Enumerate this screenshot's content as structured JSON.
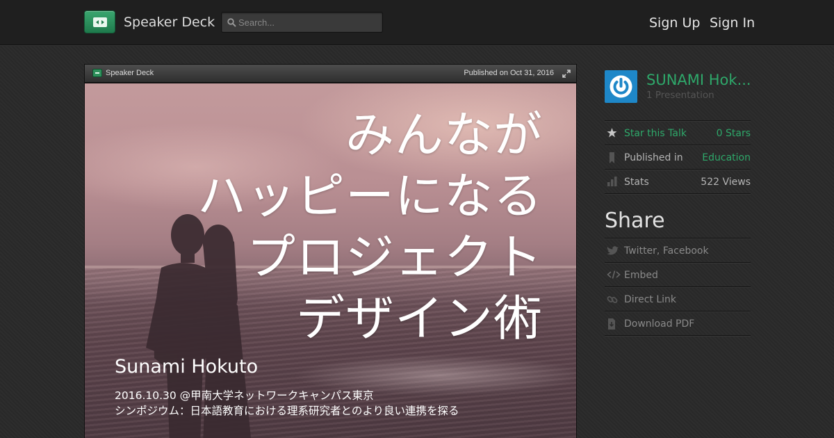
{
  "header": {
    "brand": "Speaker Deck",
    "search_placeholder": "Search...",
    "sign_up": "Sign Up",
    "sign_in": "Sign In"
  },
  "deck": {
    "bar_brand": "Speaker Deck",
    "published": "Published on Oct 31, 2016",
    "slide": {
      "title_lines": [
        "みんなが",
        "ハッピーになる",
        "プロジェクト",
        "デザイン術"
      ],
      "author": "Sunami Hokuto",
      "sub_line1": "2016.10.30 @甲南大学ネットワークキャンパス東京",
      "sub_line2": "シンポジウム：日本語教育における理系研究者とのより良い連携を探る"
    }
  },
  "sidebar": {
    "author_name": "SUNAMI Hok...",
    "presentation_count": "1 Presentation",
    "star_label": "Star this Talk",
    "star_value": "0 Stars",
    "published_label": "Published in",
    "published_value": "Education",
    "stats_label": "Stats",
    "stats_value": "522 Views",
    "share_title": "Share",
    "share_items": [
      "Twitter, Facebook",
      "Embed",
      "Direct Link",
      "Download PDF"
    ]
  },
  "colors": {
    "accent": "#2ea86a",
    "avatar": "#1e87c8",
    "background": "#2a2a2a"
  },
  "icons": [
    "speakerdeck-logo-icon",
    "search-icon",
    "expand-icon",
    "power-icon",
    "star-icon",
    "bookmark-icon",
    "stats-icon",
    "twitter-icon",
    "code-icon",
    "link-icon",
    "download-icon"
  ]
}
